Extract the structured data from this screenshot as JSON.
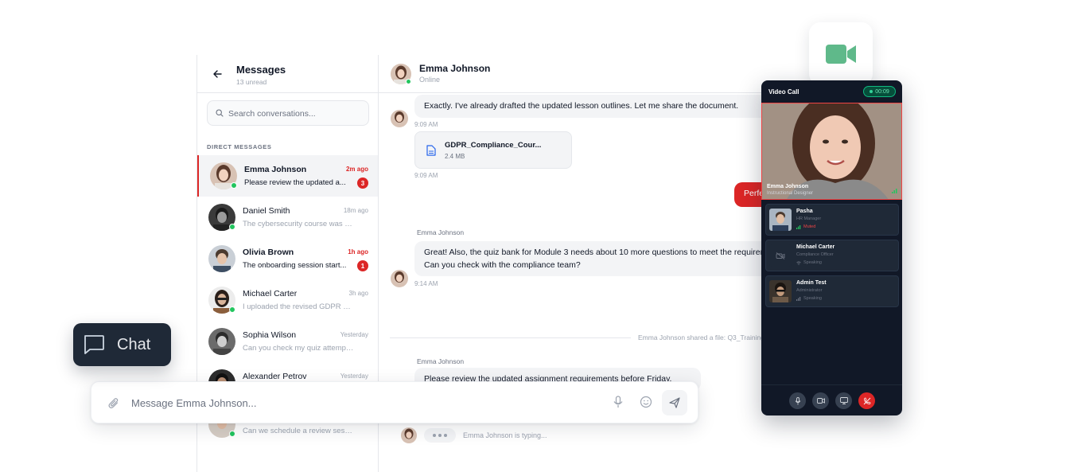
{
  "sidebar": {
    "title": "Messages",
    "subtitle": "13 unread",
    "search_placeholder": "Search conversations...",
    "section_label": "DIRECT MESSAGES",
    "conversations": [
      {
        "name": "Emma Johnson",
        "time": "2m ago",
        "preview": "Please review the updated a...",
        "unread": "3"
      },
      {
        "name": "Daniel Smith",
        "time": "18m ago",
        "preview": "The cybersecurity course was u..."
      },
      {
        "name": "Olivia Brown",
        "time": "1h ago",
        "preview": "The onboarding session start...",
        "unread": "1"
      },
      {
        "name": "Michael Carter",
        "time": "3h ago",
        "preview": "I uploaded the revised GDPR co..."
      },
      {
        "name": "Sophia Wilson",
        "time": "Yesterday",
        "preview": "Can you check my quiz attempt r..."
      },
      {
        "name": "Alexander Petrov",
        "time": "Yesterday",
        "preview": ""
      },
      {
        "name": "",
        "time": "",
        "preview": "Can we schedule a review sessio..."
      }
    ]
  },
  "chat": {
    "contact_name": "Emma Johnson",
    "contact_status": "Online",
    "messages": [
      {
        "text": "Exactly. I've already drafted the updated lesson outlines. Let me share the document.",
        "time": "9:09 AM"
      },
      {
        "file_name": "GDPR_Compliance_Cour...",
        "file_size": "2.4 MB",
        "time": "9:09 AM"
      },
      {
        "outgoing_text": "Perfect"
      },
      {
        "sender": "Emma Johnson",
        "line1": "Great! Also, the quiz bank for Module 3 needs about 10 more questions to meet the requirements.",
        "line2": "Can you check with the compliance team?",
        "time": "9:14 AM"
      },
      {
        "system": "Emma Johnson shared a file: Q3_Training"
      },
      {
        "sender": "Emma Johnson",
        "text": "Please review the updated assignment requirements before Friday."
      }
    ],
    "typing_text": "Emma Johnson is typing..."
  },
  "composer": {
    "placeholder": "Message Emma Johnson..."
  },
  "chat_pill": {
    "label": "Chat"
  },
  "video_call": {
    "title": "Video Call",
    "timer": "00:09",
    "main_name": "Emma Johnson",
    "main_role": "Instructional Designer",
    "participants": [
      {
        "name": "Pasha",
        "role": "HR Manager",
        "status": "Muted"
      },
      {
        "name": "Michael Carter",
        "role": "Compliance Officer",
        "status": "Speaking"
      },
      {
        "name": "Admin Test",
        "role": "Administrator",
        "status": "Speaking"
      }
    ]
  },
  "colors": {
    "accent_red": "#dc2626",
    "online_green": "#22c55e",
    "video_bg": "#111827",
    "camera_icon_green": "#5fb98a"
  },
  "icons": [
    "back-arrow-icon",
    "search-icon",
    "file-icon",
    "paperclip-icon",
    "microphone-icon",
    "emoji-icon",
    "send-icon",
    "chat-bubble-icon",
    "video-camera-icon",
    "camera-off-icon",
    "screen-share-icon",
    "end-call-icon",
    "signal-icon"
  ]
}
